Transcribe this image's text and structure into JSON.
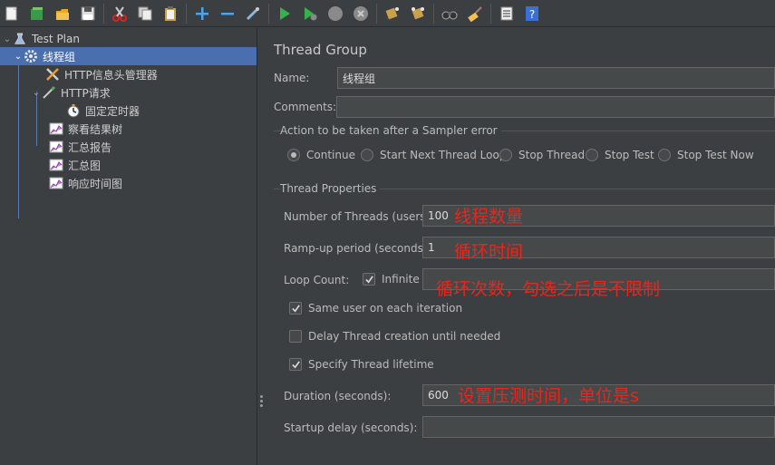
{
  "toolbar": {
    "buttons": [
      "new-icon",
      "templates-icon",
      "open-icon",
      "save-icon",
      "cut-icon",
      "copy-icon",
      "paste-icon",
      "expand-icon",
      "collapse-icon",
      "toggle-icon",
      "start-icon",
      "start-no-pause-icon",
      "stop-icon",
      "shutdown-icon",
      "clear-icon",
      "clear-all-icon",
      "search-icon",
      "reset-search-icon",
      "function-helper-icon",
      "help-icon"
    ]
  },
  "tree": {
    "items": [
      {
        "label": "Test Plan",
        "icon": "test-plan-icon"
      },
      {
        "label": "线程组",
        "icon": "gear-icon"
      },
      {
        "label": "HTTP信息头管理器",
        "icon": "wrench-icon"
      },
      {
        "label": "HTTP请求",
        "icon": "pipette-icon"
      },
      {
        "label": "固定定时器",
        "icon": "stopwatch-icon"
      },
      {
        "label": "察看结果树",
        "icon": "chart-icon"
      },
      {
        "label": "汇总报告",
        "icon": "chart-icon"
      },
      {
        "label": "汇总图",
        "icon": "chart-icon"
      },
      {
        "label": "响应时间图",
        "icon": "chart-icon"
      }
    ]
  },
  "panel": {
    "title": "Thread Group",
    "name_label": "Name:",
    "name_value": "线程组",
    "comments_label": "Comments:",
    "comments_value": "",
    "error_section": "Action to be taken after a Sampler error",
    "error_options": [
      "Continue",
      "Start Next Thread Loop",
      "Stop Thread",
      "Stop Test",
      "Stop Test Now"
    ],
    "error_selected": "Continue",
    "props_section": "Thread Properties",
    "threads_label": "Number of Threads (users):",
    "threads_value": "100",
    "rampup_label": "Ramp-up period (seconds):",
    "rampup_value": "1",
    "loop_label": "Loop Count:",
    "infinite_label": "Infinite",
    "infinite_checked": true,
    "loop_value": "",
    "same_user_label": "Same user on each iteration",
    "same_user_checked": true,
    "delay_label": "Delay Thread creation until needed",
    "delay_checked": false,
    "lifetime_label": "Specify Thread lifetime",
    "lifetime_checked": true,
    "duration_label": "Duration (seconds):",
    "duration_value": "600",
    "startup_label": "Startup delay (seconds):",
    "startup_value": ""
  },
  "annotations": {
    "threads": "线程数量",
    "rampup": "循环时间",
    "loop": "循环次数，勾选之后是不限制",
    "duration": "设置压测时间，单位是s"
  },
  "colors": {
    "background": "#3c3f41",
    "selection": "#4b6eaf",
    "annotation": "#e8261c",
    "input": "#45494a"
  }
}
